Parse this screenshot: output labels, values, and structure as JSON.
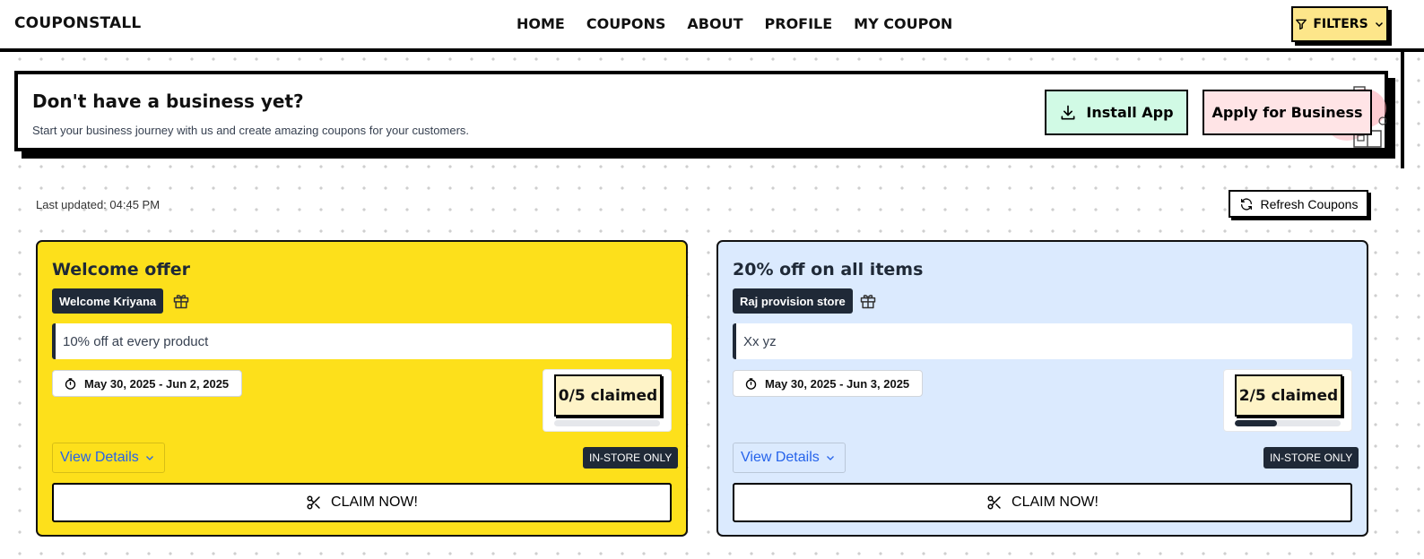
{
  "brand": {
    "logo": "COUPONSTALL"
  },
  "nav": {
    "home": "HOME",
    "coupons": "COUPONS",
    "about": "ABOUT",
    "profile": "PROFILE",
    "my_coupon": "MY COUPON"
  },
  "filters": {
    "label": "FILTERS"
  },
  "banner": {
    "title": "Don't have a business yet?",
    "subtitle": "Start your business journey with us and create amazing coupons for your customers.",
    "install_label": "Install App",
    "apply_label": "Apply for Business"
  },
  "toolbar": {
    "last_updated": "Last updated: 04:45 PM",
    "refresh_label": "Refresh Coupons"
  },
  "coupons": [
    {
      "title": "Welcome offer",
      "business": "Welcome Kriyana",
      "description": "10% off at every product",
      "dates": "May 30, 2025 - Jun 2, 2025",
      "claimed_text": "0/5 claimed",
      "claimed": 0,
      "total": 5,
      "view_details": "View Details",
      "badge": "IN-STORE ONLY",
      "claim_label": "CLAIM NOW!",
      "bg_color": "#fde01b"
    },
    {
      "title": "20% off on all items",
      "business": "Raj provision store",
      "description": "Xx yz",
      "dates": "May 30, 2025 - Jun 3, 2025",
      "claimed_text": "2/5 claimed",
      "claimed": 2,
      "total": 5,
      "view_details": "View Details",
      "badge": "IN-STORE ONLY",
      "claim_label": "CLAIM NOW!",
      "bg_color": "#dbeafe"
    }
  ],
  "colors": {
    "accent_yellow": "#fde68a",
    "install_green": "#d1fae5",
    "apply_pink": "#ffe4e6",
    "dark": "#1f2937",
    "link_blue": "#2563eb"
  }
}
